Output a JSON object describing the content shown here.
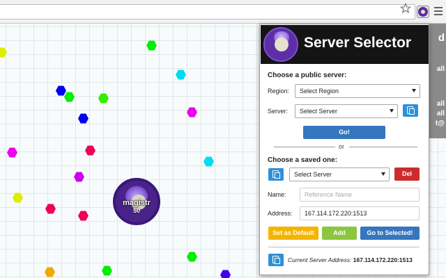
{
  "browser": {
    "star_icon": "star-icon",
    "extension_icon": "server-selector-extension-icon",
    "menu_icon": "hamburger-menu-icon"
  },
  "game": {
    "player": {
      "name": "magistr",
      "mass": "50"
    },
    "background_panel": {
      "lines": [
        "d",
        "all",
        "all",
        "all",
        "t@"
      ]
    },
    "food_colors": [
      "#00ff00",
      "#0000ff",
      "#ff00ff",
      "#00ffff",
      "#ff0080",
      "#ffff00",
      "#ffaa00"
    ]
  },
  "popup": {
    "title": "Server Selector",
    "public": {
      "heading": "Choose a public server:",
      "region_label": "Region:",
      "region_value": "Select Region",
      "server_label": "Server:",
      "server_value": "Select Server",
      "go_label": "Go!"
    },
    "or_label": "or",
    "saved": {
      "heading": "Choose a saved one:",
      "server_value": "Select Server",
      "delete_label": "Del"
    },
    "name_label": "Name:",
    "name_placeholder": "Reference Name",
    "address_label": "Address:",
    "address_value": "167.114.172.220:1513",
    "buttons": {
      "set_default": "Set as Default",
      "add": "Add",
      "go_selected": "Go to Selected!"
    },
    "current": {
      "label": "Current Server Address:",
      "value": "167.114.172.220:1513"
    },
    "colors": {
      "go_blue": "#3576be",
      "del_red": "#cc2c2c",
      "default_orange": "#f5b400",
      "add_green": "#8cc63f",
      "icon_blue": "#2f8fd8"
    }
  }
}
